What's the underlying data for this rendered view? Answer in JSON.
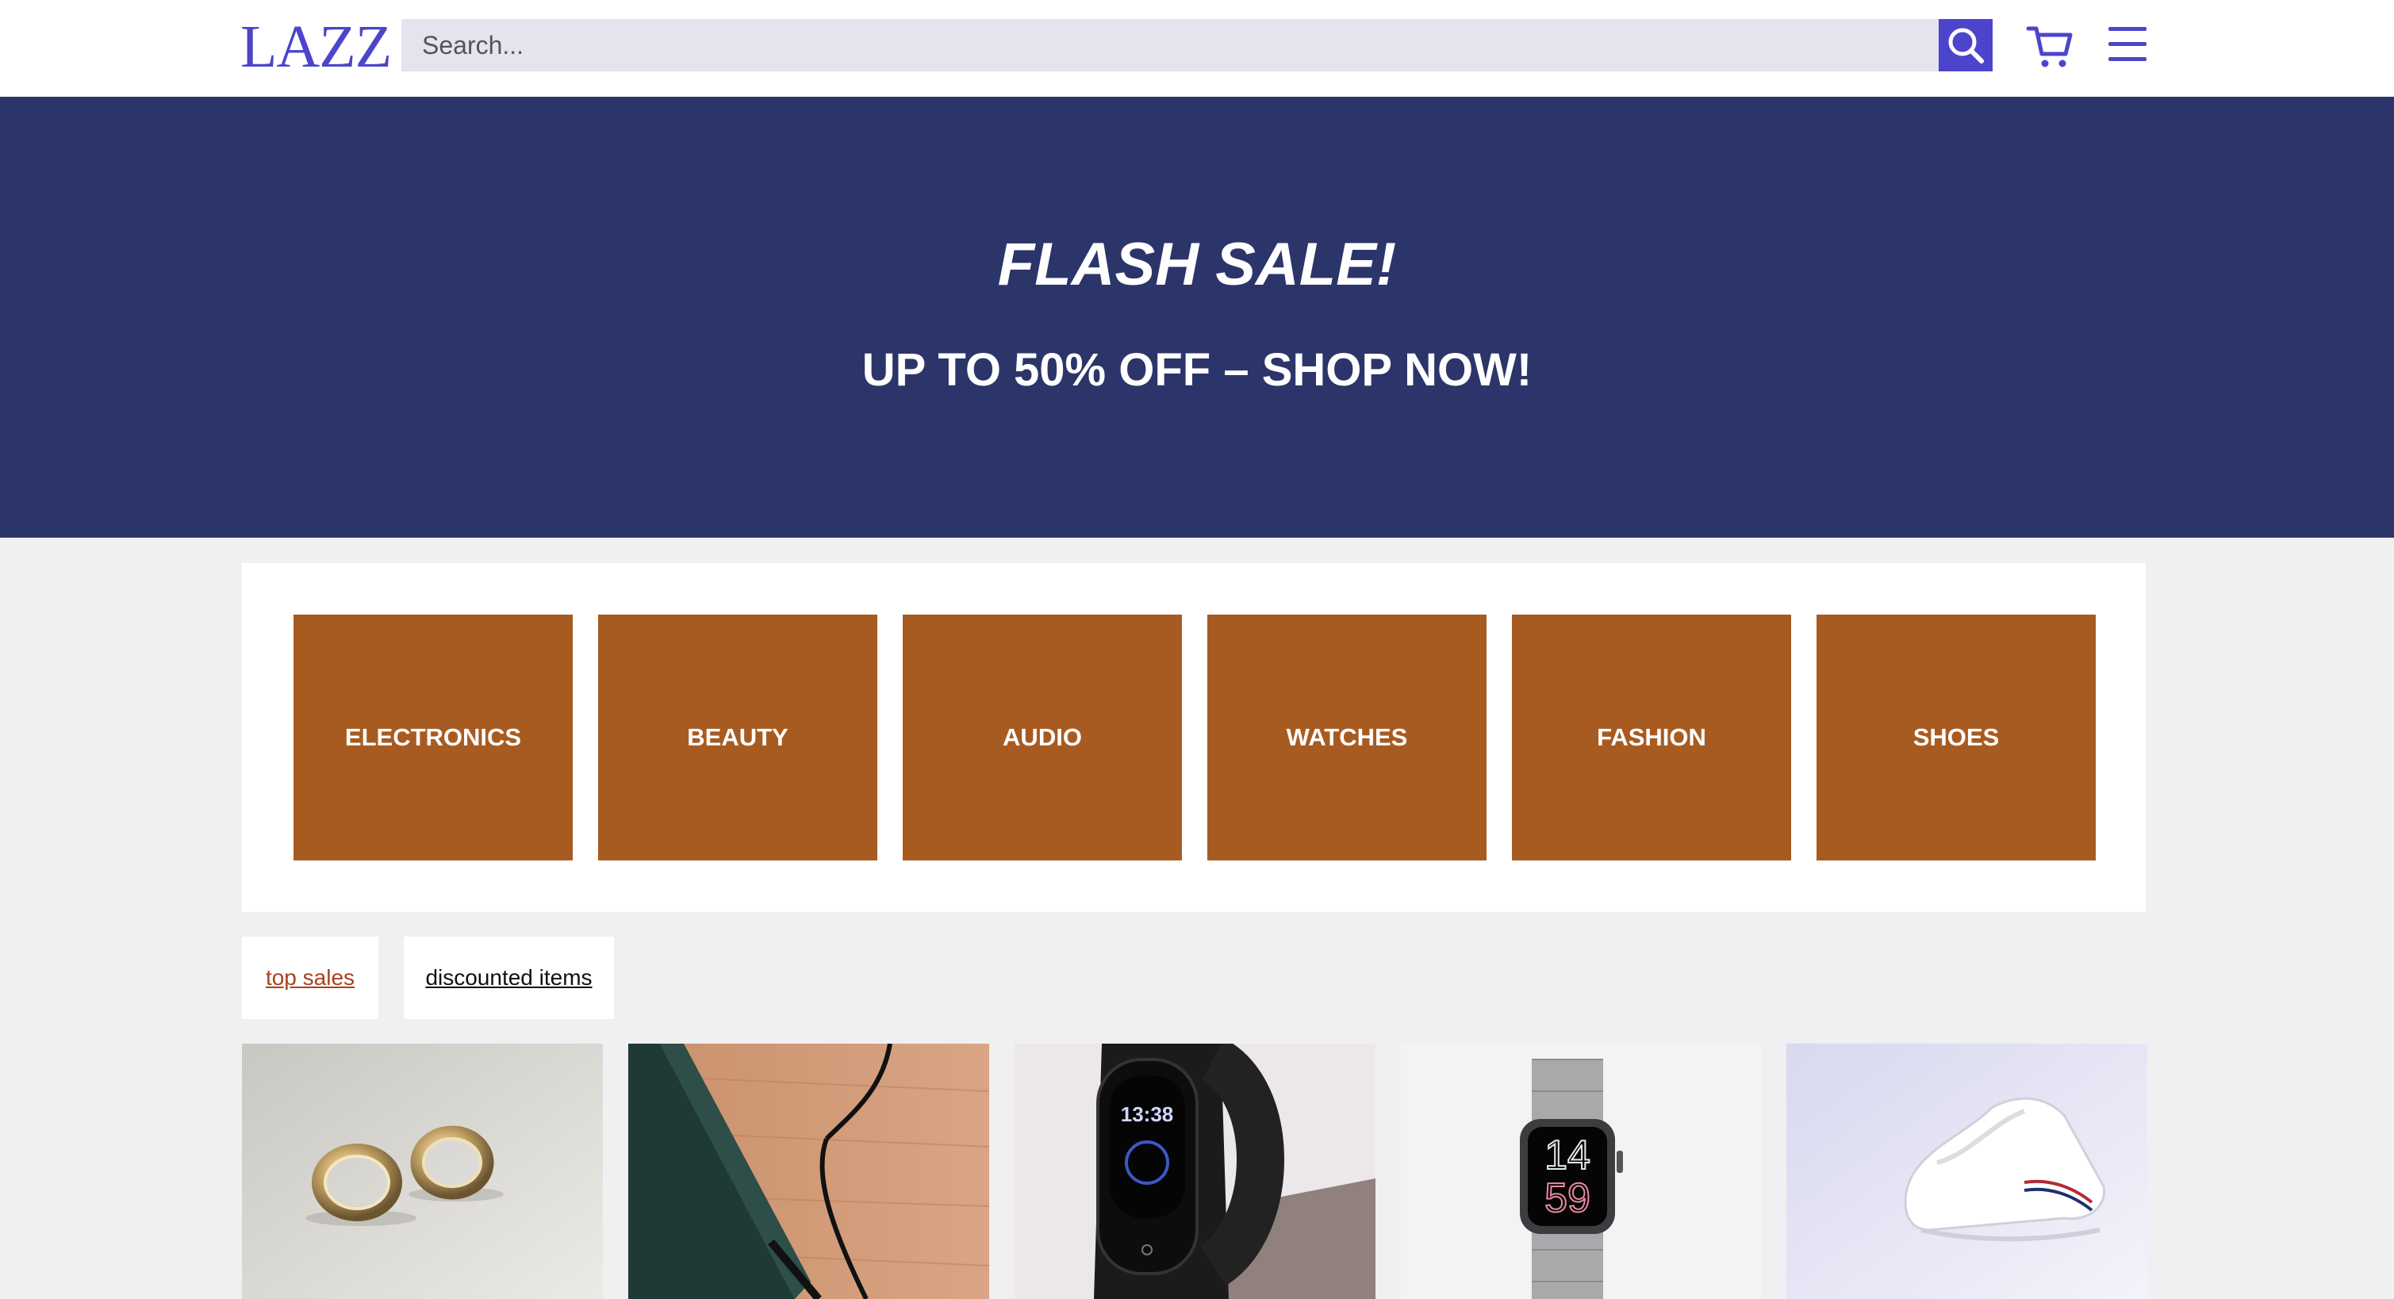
{
  "header": {
    "logo": "LAZZ",
    "search_placeholder": "Search...",
    "search_icon": "search-icon",
    "cart_icon": "cart-icon",
    "menu_icon": "hamburger-menu-icon"
  },
  "banner": {
    "title": "FLASH SALE!",
    "subtitle": "UP TO 50% OFF – SHOP NOW!"
  },
  "categories": [
    {
      "label": "ELECTRONICS"
    },
    {
      "label": "BEAUTY"
    },
    {
      "label": "AUDIO"
    },
    {
      "label": "WATCHES"
    },
    {
      "label": "FASHION"
    },
    {
      "label": "SHOES"
    }
  ],
  "tabs": {
    "top_sales": "top sales",
    "discounted_items": "discounted items"
  },
  "products": [
    {
      "image": "gold-hoop-earrings"
    },
    {
      "image": "phone-with-charging-cable"
    },
    {
      "image": "fitness-tracker-band"
    },
    {
      "image": "smartwatch-with-nylon-strap"
    },
    {
      "image": "white-sneakers"
    }
  ],
  "product_watch_screen": {
    "line1": "14",
    "line2": "59"
  },
  "product_band_screen": {
    "time": "13:38"
  },
  "colors": {
    "brand": "#4c45cc",
    "banner_bg": "#2c3569",
    "category_tile": "#a85b21",
    "active_tab": "#a8421f",
    "page_bg": "#f0eff1"
  }
}
